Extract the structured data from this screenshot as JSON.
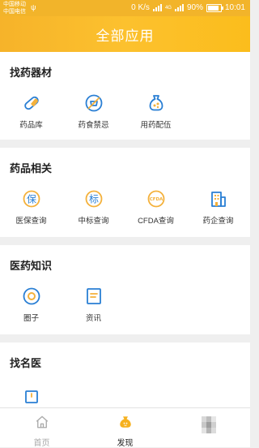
{
  "status_bar": {
    "carrier1": "中国移动",
    "carrier2": "中国电信",
    "network_speed": "0 K/s",
    "network_type": "4G",
    "battery": "90%",
    "battery_level": 0.9,
    "time": "10:01"
  },
  "header": {
    "title": "全部应用"
  },
  "sections": {
    "find_meds": {
      "title": "找药器材",
      "items": [
        {
          "label": "药品库",
          "icon": "capsule-icon"
        },
        {
          "label": "药食禁忌",
          "icon": "forbidden-food-icon"
        },
        {
          "label": "用药配伍",
          "icon": "medicine-bag-icon"
        }
      ]
    },
    "drug_related": {
      "title": "药品相关",
      "items": [
        {
          "label": "医保查询",
          "icon": "insurance-icon",
          "glyph": "保"
        },
        {
          "label": "中标查询",
          "icon": "bid-icon",
          "glyph": "标"
        },
        {
          "label": "CFDA查询",
          "icon": "cfda-icon",
          "glyph": "CFDA"
        },
        {
          "label": "药企查询",
          "icon": "company-building-icon"
        }
      ]
    },
    "knowledge": {
      "title": "医药知识",
      "items": [
        {
          "label": "圈子",
          "icon": "circle-icon"
        },
        {
          "label": "资讯",
          "icon": "news-icon"
        }
      ]
    },
    "find_doctor": {
      "title": "找名医",
      "items": [
        {
          "label": "",
          "icon": "doctor-card-icon"
        }
      ]
    }
  },
  "tabbar": {
    "tabs": [
      {
        "label": "首页",
        "icon": "home-icon",
        "active": false
      },
      {
        "label": "发现",
        "icon": "discover-bag-icon",
        "active": true
      },
      {
        "label": "",
        "icon": "pixelated-avatar-icon",
        "active": false
      }
    ]
  },
  "colors": {
    "brand_yellow": "#fbbd1c",
    "icon_blue": "#2a7fd4",
    "icon_accent": "#f4b13b"
  }
}
